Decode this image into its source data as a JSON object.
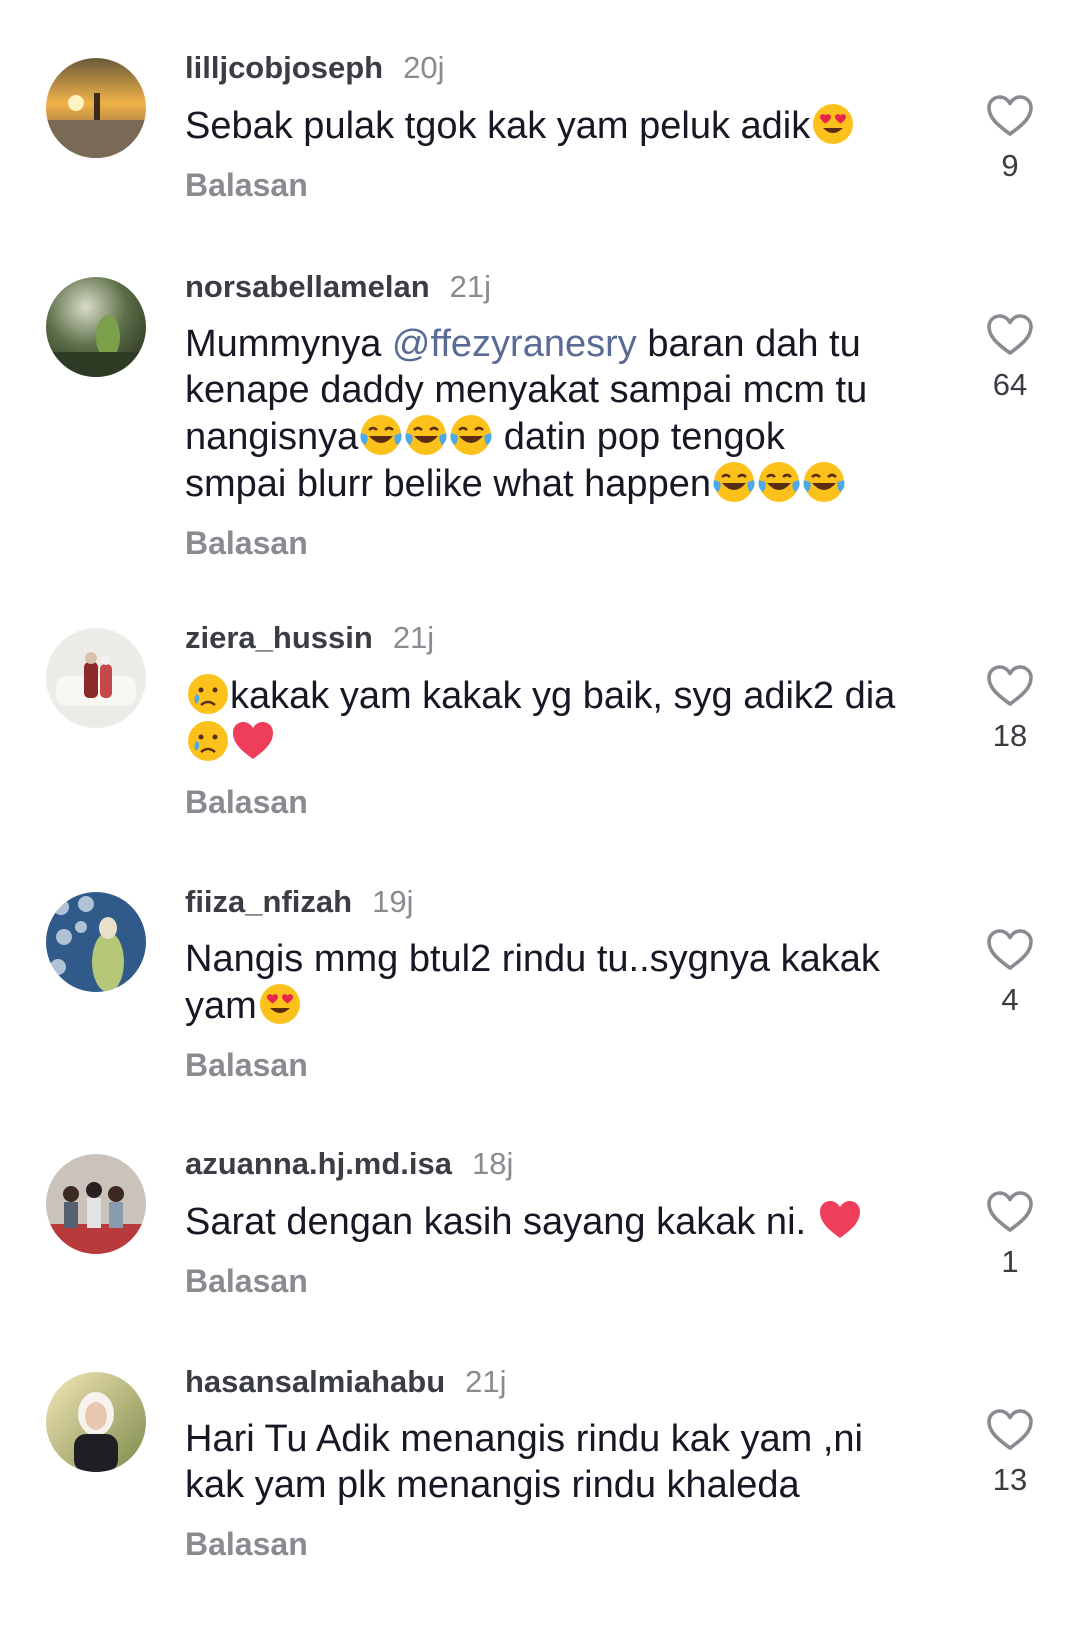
{
  "comments": [
    {
      "username": "lilljcobjoseph",
      "time": "20j",
      "text_parts": [
        "Sebak pulak tgok kak yam peluk adik"
      ],
      "reply_label": "Balasan",
      "likes": "9"
    },
    {
      "username": "norsabellamelan",
      "time": "21j",
      "line1_pre": "Mummynya ",
      "line1_mention": "@ffezyranesry",
      "line1_post": " baran dah tu",
      "line2": "kenape daddy menyakat sampai mcm tu",
      "line3_pre": "nangisnya",
      "line3_post": " datin pop tengok",
      "line4": "smpai blurr belike what happen",
      "reply_label": "Balasan",
      "likes": "64"
    },
    {
      "username": "ziera_hussin",
      "time": "21j",
      "line1": "kakak yam kakak yg baik, syg adik2 dia",
      "reply_label": "Balasan",
      "likes": "18"
    },
    {
      "username": "fiiza_nfizah",
      "time": "19j",
      "line1": "Nangis mmg btul2 rindu tu..sygnya kakak",
      "line2": "yam",
      "reply_label": "Balasan",
      "likes": "4"
    },
    {
      "username": "azuanna.hj.md.isa",
      "time": "18j",
      "line1": "Sarat dengan kasih sayang kakak ni. ",
      "reply_label": "Balasan",
      "likes": "1"
    },
    {
      "username": "hasansalmiahabu",
      "time": "21j",
      "line1": "Hari Tu Adik menangis rindu kak yam ,ni",
      "line2": "kak yam plk menangis rindu khaleda",
      "reply_label": "Balasan",
      "likes": "13"
    }
  ],
  "icons": {
    "like": "heart-outline-icon",
    "emoji_heart_eyes": "heart-eyes-emoji",
    "emoji_laugh": "tears-of-joy-emoji",
    "emoji_cry": "crying-face-emoji",
    "emoji_heart": "red-heart-emoji"
  },
  "colors": {
    "username": "#3b3d44",
    "time": "#8a8b91",
    "text": "#161823",
    "mention": "#5a6b96",
    "reply": "#8a8b91"
  }
}
